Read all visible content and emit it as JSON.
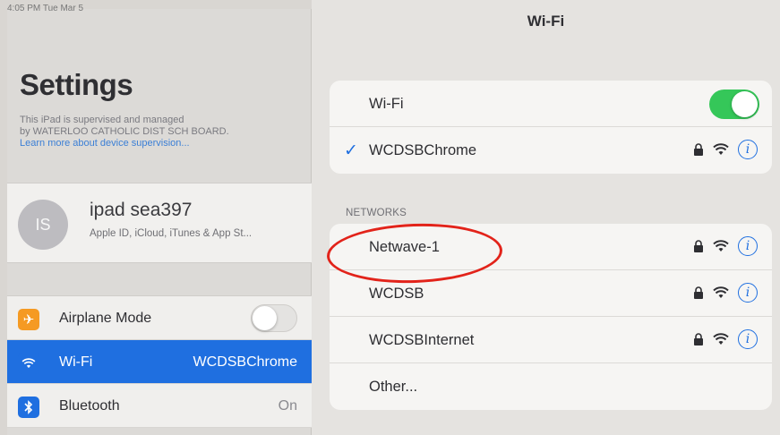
{
  "status_bar": {
    "text": "4:05 PM  Tue Mar 5"
  },
  "sidebar": {
    "title": "Settings",
    "supervision_line1": "This iPad is supervised and managed",
    "supervision_line2": "by WATERLOO CATHOLIC DIST SCH BOARD.",
    "supervision_link": "Learn more about device supervision...",
    "account": {
      "initials": "IS",
      "name": "ipad sea397",
      "subtitle": "Apple ID, iCloud, iTunes & App St..."
    },
    "items": [
      {
        "label": "Airplane Mode",
        "value": "",
        "icon": "airplane-icon",
        "icon_color": "#f59a23"
      },
      {
        "label": "Wi-Fi",
        "value": "WCDSBChrome",
        "icon": "wifi-icon",
        "icon_color": "#1f6fe0"
      },
      {
        "label": "Bluetooth",
        "value": "On",
        "icon": "bluetooth-icon",
        "icon_color": "#1f6fe0"
      }
    ]
  },
  "main": {
    "title": "Wi-Fi",
    "wifi_toggle_label": "Wi-Fi",
    "connected_network": "WCDSBChrome",
    "networks_header": "NETWORKS",
    "networks": [
      "Netwave-1",
      "WCDSB",
      "WCDSBInternet"
    ],
    "other_label": "Other..."
  },
  "colors": {
    "accent": "#1f6fe0",
    "toggle_on": "#35c759",
    "highlight": "#e2231a"
  }
}
